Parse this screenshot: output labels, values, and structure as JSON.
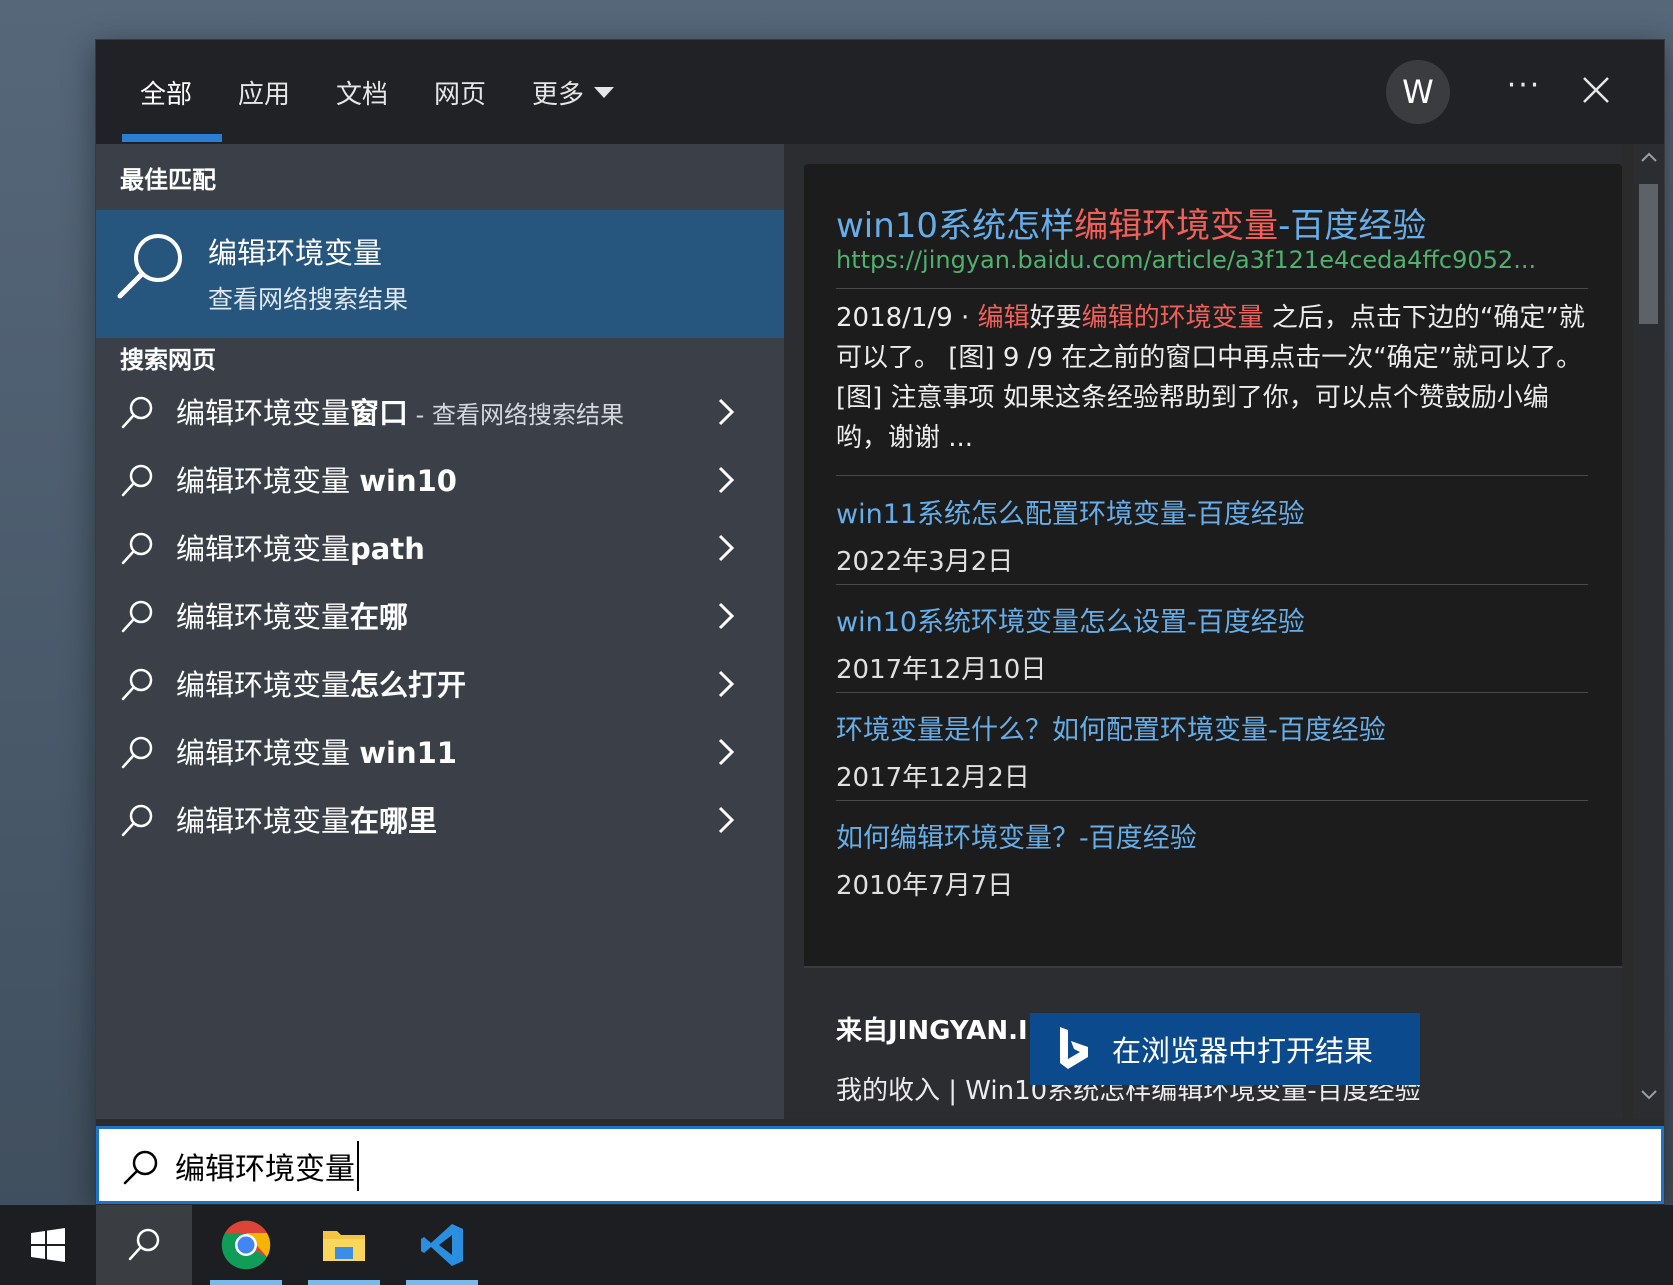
{
  "tabs": [
    {
      "label": "全部",
      "active": true
    },
    {
      "label": "应用",
      "active": false
    },
    {
      "label": "文档",
      "active": false
    },
    {
      "label": "网页",
      "active": false
    },
    {
      "label": "更多",
      "active": false
    }
  ],
  "header": {
    "avatar_letter": "W",
    "more_label": "···"
  },
  "left": {
    "best_match_title": "最佳匹配",
    "best_match": {
      "title": "编辑环境变量",
      "subtitle": "查看网络搜索结果"
    },
    "search_web_title": "搜索网页",
    "suggestions": [
      {
        "prefix": "编辑环境变量",
        "bold": "窗口",
        "hint": " - 查看网络搜索结果"
      },
      {
        "prefix": "编辑环境变量 ",
        "bold": "win10",
        "hint": ""
      },
      {
        "prefix": "编辑环境变量",
        "bold": "path",
        "hint": ""
      },
      {
        "prefix": "编辑环境变量",
        "bold": "在哪",
        "hint": ""
      },
      {
        "prefix": "编辑环境变量",
        "bold": "怎么打开",
        "hint": ""
      },
      {
        "prefix": "编辑环境变量 ",
        "bold": "win11",
        "hint": ""
      },
      {
        "prefix": "编辑环境变量",
        "bold": "在哪里",
        "hint": ""
      }
    ]
  },
  "result": {
    "title_pre": "win10系统怎样",
    "title_hl": "编辑环境变量",
    "title_post": "-百度经验",
    "url": "https://jingyan.baidu.com/article/a3f121e4ceda4ffc9052...",
    "snippet": {
      "date": "2018/1/9 · ",
      "hl1": "编辑",
      "mid": "好要",
      "hl2": "编辑的环境变量",
      "rest": " 之后，点击下边的“确定”就可以了。 [图] 9 /9 在之前的窗口中再点击一次“确定”就可以了。 [图] 注意事项 如果这条经验帮助到了你，可以点个赞鼓励小编哟，谢谢 ..."
    },
    "related": [
      {
        "title": "win11系统怎么配置环境变量-百度经验",
        "date": "2022年3月2日"
      },
      {
        "title": "win10系统环境变量怎么设置-百度经验",
        "date": "2017年12月10日"
      },
      {
        "title": "环境变量是什么？如何配置环境变量-百度经验",
        "date": "2017年12月2日"
      },
      {
        "title": "如何编辑环境变量？-百度经验",
        "date": "2010年7月7日"
      }
    ],
    "source_label": "来自JINGYAN.I",
    "source_text": "我的收入 | Win10系统怎样编辑环境变量-百度经验",
    "open_browser_label": "在浏览器中打开结果"
  },
  "search_box": {
    "value": "编辑环境变量"
  },
  "taskbar": {
    "items": [
      "start-icon",
      "search-icon",
      "chrome-icon",
      "file-explorer-icon",
      "vscode-icon"
    ]
  },
  "colors": {
    "accent": "#2a7fd4",
    "best_match_bg": "#26557d",
    "link": "#67aee8",
    "highlight": "#f0605a",
    "url": "#4fb16d",
    "open_button": "#0b4a8c"
  }
}
